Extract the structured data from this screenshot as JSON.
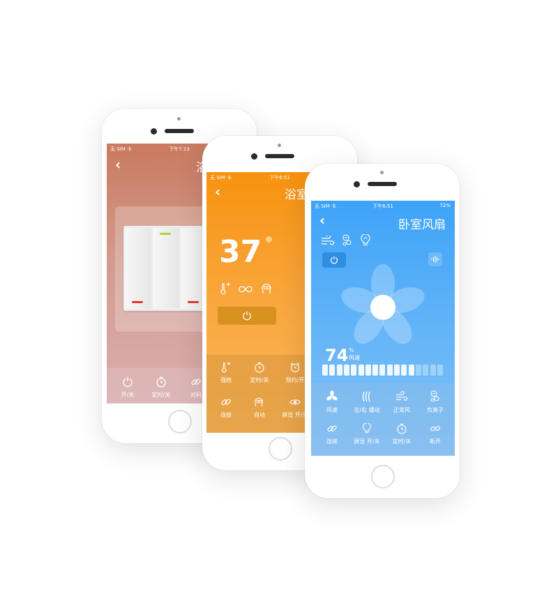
{
  "phone_left": {
    "status": {
      "carrier": "无 SIM 卡",
      "time": "下午7:13"
    },
    "title": "浴室",
    "controls": [
      {
        "icon": "power-icon",
        "label": "开/关"
      },
      {
        "icon": "timer-icon",
        "label": "定时/关"
      },
      {
        "icon": "link-icon",
        "label": "对码"
      }
    ]
  },
  "phone_middle": {
    "status": {
      "carrier": "无 SIM 卡",
      "time": "下午6:51"
    },
    "title": "浴室",
    "temperature": "37",
    "row1": [
      {
        "icon": "thermometer-plus-icon",
        "label": "强档"
      },
      {
        "icon": "timer-icon",
        "label": "定时/关"
      },
      {
        "icon": "alarm-clock-icon",
        "label": "预约/开"
      }
    ],
    "row2": [
      {
        "icon": "link-icon",
        "label": "连接"
      },
      {
        "icon": "auto-head-icon",
        "label": "自动"
      },
      {
        "icon": "eye-icon",
        "label": "屏显 开/关"
      }
    ]
  },
  "phone_right": {
    "status": {
      "carrier": "无 SIM 卡",
      "time": "下午6:51",
      "battery": "72%"
    },
    "title": "卧室风扇",
    "speed_value": "74",
    "speed_unit": "%",
    "speed_label": "风速",
    "speed_level": 0.74,
    "row1": [
      {
        "icon": "fan-icon",
        "label": "风速"
      },
      {
        "icon": "swing-icon",
        "label": "左/右 摆动"
      },
      {
        "icon": "wind-icon",
        "label": "正常风"
      },
      {
        "icon": "ion-icon",
        "label": "负离子"
      }
    ],
    "row2": [
      {
        "icon": "link-icon",
        "label": "连接"
      },
      {
        "icon": "bulb-icon",
        "label": "屏显 开/关"
      },
      {
        "icon": "timer-icon",
        "label": "定时/关"
      },
      {
        "icon": "broken-link-icon",
        "label": "断开"
      }
    ]
  }
}
